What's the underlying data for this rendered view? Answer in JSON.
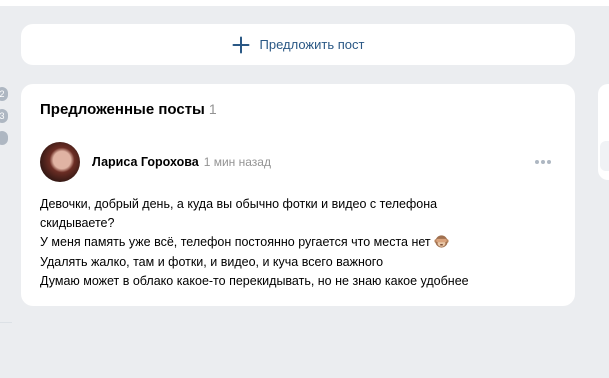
{
  "suggest": {
    "label": "Предложить пост",
    "icon": "plus-icon"
  },
  "left_badges": [
    "2",
    "3",
    ""
  ],
  "posts": {
    "title": "Предложенные посты",
    "count": "1",
    "items": [
      {
        "author": "Лариса Горохова",
        "time": "1 мин назад",
        "lines": [
          "Девочки, добрый день, а куда вы обычно фотки и видео с телефона",
          "скидываете?",
          "У меня память уже всё, телефон постоянно ругается что места нет",
          "Удалять жалко, там и фотки, и видео, и куча всего важного",
          "Думаю может в облако какое-то перекидывать, но не знаю какое удобнее"
        ],
        "emoji": "see-no-evil-monkey-icon"
      }
    ]
  },
  "colors": {
    "accent": "#2a5885",
    "background": "#ebedf0",
    "muted": "#939393"
  }
}
